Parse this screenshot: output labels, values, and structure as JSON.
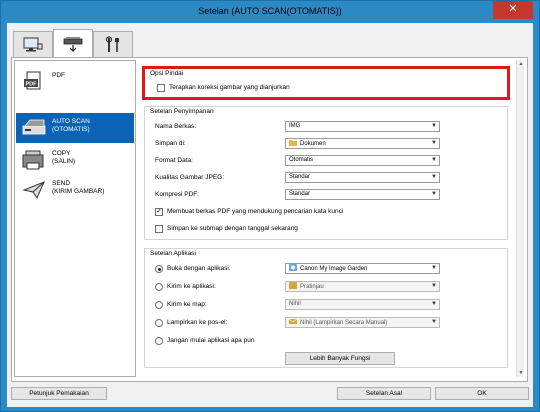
{
  "window": {
    "title": "Setelan (AUTO SCAN(OTOMATIS))",
    "close_glyph": "✕"
  },
  "tabs": [
    {
      "icon": "scanner-from-computer-icon"
    },
    {
      "icon": "scanner-panel-icon",
      "active": true
    },
    {
      "icon": "tools-icon"
    }
  ],
  "sidebar": {
    "items": [
      {
        "label": "PDF",
        "icon": "pdf-icon"
      },
      {
        "label": "AUTO SCAN\n(OTOMATIS)",
        "icon": "auto-scan-icon",
        "active": true
      },
      {
        "label": "COPY\n(SALIN)",
        "icon": "copy-icon"
      },
      {
        "label": "SEND\n(KIRIM GAMBAR)",
        "icon": "send-icon"
      }
    ]
  },
  "scan_options": {
    "title": "Opsi Pindai",
    "apply_correction": {
      "label": "Terapkan koreksi gambar yang dianjurkan",
      "checked": false
    }
  },
  "save_settings": {
    "title": "Setelan Penyimpanan",
    "file_name": {
      "label": "Nama Berkas:",
      "value": "IMG"
    },
    "save_in": {
      "label": "Simpan di:",
      "value": "Dokumen"
    },
    "data_format": {
      "label": "Format Data:",
      "value": "Otomatis"
    },
    "jpeg_quality": {
      "label": "Kualitas Gambar JPEG:",
      "value": "Standar"
    },
    "pdf_compression": {
      "label": "Kompresi PDF:",
      "value": "Standar"
    },
    "searchable_pdf": {
      "label": "Membuat berkas PDF yang mendukung pencarian kata kunci",
      "checked": true
    },
    "subfolder_date": {
      "label": "Simpan ke submap dengan tanggal sekarang",
      "checked": false
    }
  },
  "app_settings": {
    "title": "Setelan Aplikasi",
    "options": [
      {
        "label": "Buka dengan aplikasi:",
        "value": "Canon My Image Garden",
        "selected": true,
        "disabled": false,
        "icon": "app-icon"
      },
      {
        "label": "Kirim ke aplikasi:",
        "value": "Pratinjau",
        "selected": false,
        "disabled": true,
        "icon": "app-icon"
      },
      {
        "label": "Kirim ke map:",
        "value": "Nihil",
        "selected": false,
        "disabled": true,
        "icon": ""
      },
      {
        "label": "Lampirkan ke pos-el:",
        "value": "Nihil (Lampirkan Secara Manual)",
        "selected": false,
        "disabled": true,
        "icon": "mail-icon"
      },
      {
        "label": "Jangan mulai aplikasi apa pun",
        "selected": false
      }
    ],
    "more_functions": "Lebih Banyak Fungsi"
  },
  "footer": {
    "instructions": "Petunjuk Pemakaian",
    "defaults": "Setelan Asal",
    "ok": "OK"
  },
  "colors": {
    "accent": "#0b63b5",
    "highlight": "#e0161d",
    "titlebar": "#2b8ac6",
    "close": "#c7372f"
  }
}
